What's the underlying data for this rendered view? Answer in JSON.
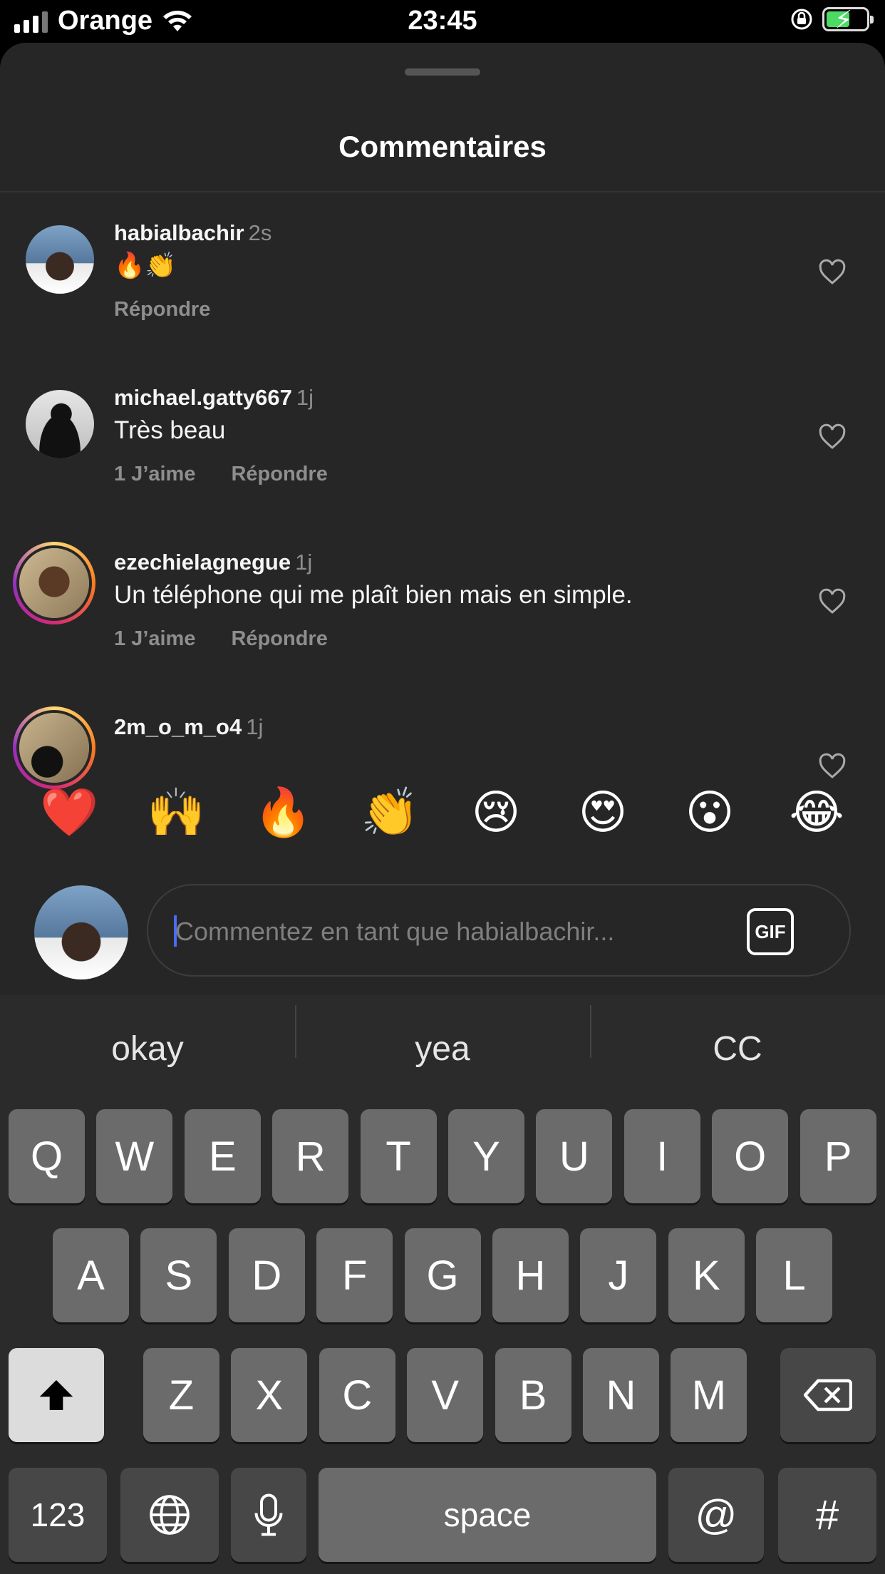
{
  "status_bar": {
    "carrier": "Orange",
    "time": "23:45",
    "battery_level": 0.6
  },
  "sheet": {
    "title": "Commentaires"
  },
  "comments": [
    {
      "username": "habialbachir",
      "time": "2s",
      "text": "🔥👏",
      "likes": "",
      "reply": "Répondre"
    },
    {
      "username": "michael.gatty667",
      "time": "1j",
      "text": "Très beau",
      "likes": "1 J’aime",
      "reply": "Répondre"
    },
    {
      "username": "ezechielagnegue",
      "time": "1j",
      "text": "Un téléphone qui me plaît bien mais en simple.",
      "likes": "1 J’aime",
      "reply": "Répondre"
    },
    {
      "username": "2m_o_m_o4",
      "time": "1j",
      "text": "",
      "likes": "",
      "reply": ""
    }
  ],
  "reactions": [
    "❤️",
    "🙌",
    "🔥",
    "👏",
    "😢",
    "😍",
    "😮",
    "😂"
  ],
  "composer": {
    "placeholder": "Commentez en tant que habialbachir...",
    "gif_label": "GIF"
  },
  "keyboard": {
    "suggestions": [
      "okay",
      "yea",
      "CC"
    ],
    "row1": [
      "Q",
      "W",
      "E",
      "R",
      "T",
      "Y",
      "U",
      "I",
      "O",
      "P"
    ],
    "row2": [
      "A",
      "S",
      "D",
      "F",
      "G",
      "H",
      "J",
      "K",
      "L"
    ],
    "row3": [
      "Z",
      "X",
      "C",
      "V",
      "B",
      "N",
      "M"
    ],
    "numbers_label": "123",
    "space_label": "space",
    "at_label": "@",
    "hash_label": "#"
  }
}
